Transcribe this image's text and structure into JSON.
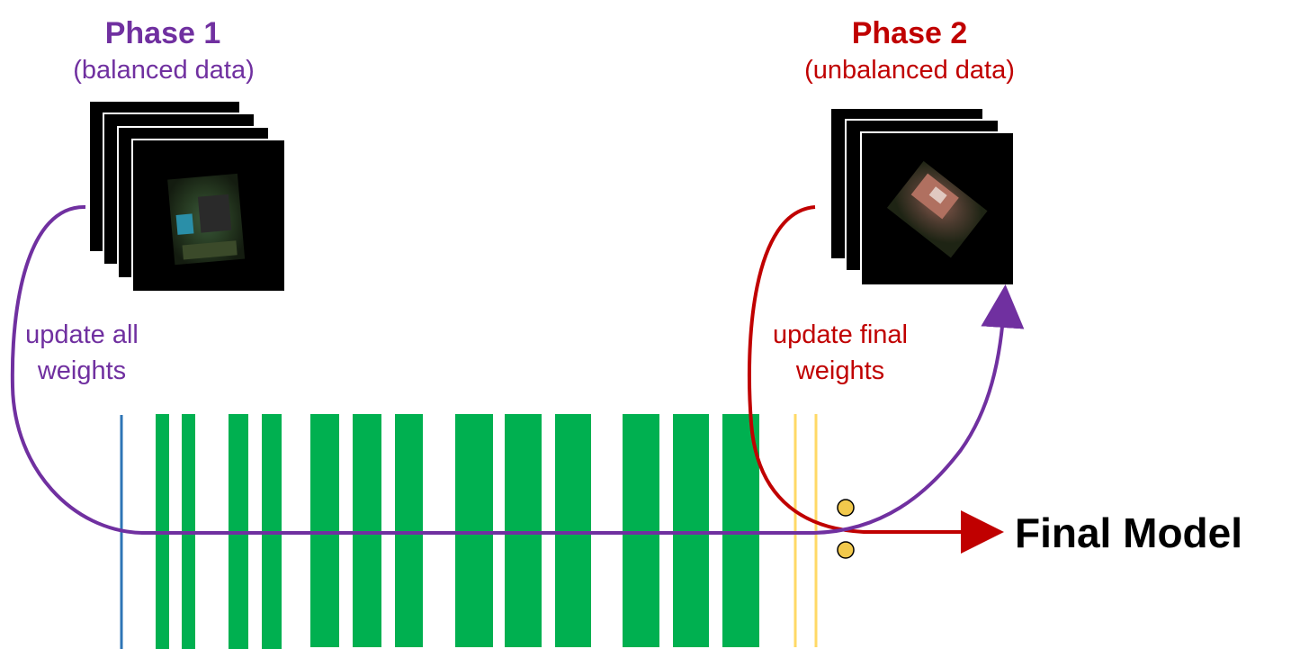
{
  "phase1": {
    "title": "Phase 1",
    "subtitle": "(balanced data)",
    "color": "#7030a0"
  },
  "phase2": {
    "title": "Phase 2",
    "subtitle": "(unbalanced data)",
    "color": "#c00000"
  },
  "annotations": {
    "phase1_update_line1": "update all",
    "phase1_update_line2": "weights",
    "phase2_update_line1": "update final",
    "phase2_update_line2": "weights"
  },
  "output": {
    "label": "Final Model"
  },
  "colors": {
    "layer_green": "#00b050",
    "input_line_blue": "#2e75b6",
    "final_layer_yellow": "#ffd966",
    "node_fill": "#f2c94c",
    "frame_black": "#000000"
  },
  "icons": {
    "phase1_image": "aerial-house-image",
    "phase2_image": "aerial-house-image"
  }
}
